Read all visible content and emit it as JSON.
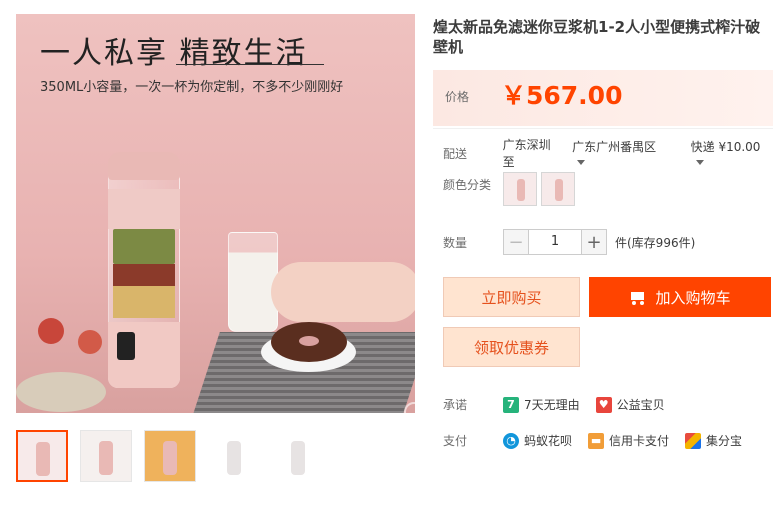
{
  "hero": {
    "title": "一人私享 精致生活",
    "subtitle": "350ML小容量，一次一杯为你定制，不多不少刚刚好"
  },
  "product": {
    "title": "煌太新品免滤迷你豆浆机1-2人小型便携式榨汁破壁机",
    "price_label": "价格",
    "price": "￥567.00"
  },
  "shipping": {
    "label": "配送",
    "from": "广东深圳 至",
    "to": "广东广州番禺区",
    "fee": "快递 ¥10.00"
  },
  "color": {
    "label": "颜色分类"
  },
  "quantity": {
    "label": "数量",
    "value": "1",
    "minus": "−",
    "plus": "+",
    "stock": "件(库存996件)"
  },
  "actions": {
    "buy_now": "立即购买",
    "add_cart": "加入购物车",
    "coupon": "领取优惠券"
  },
  "promise": {
    "label": "承诺",
    "items": [
      "7天无理由",
      "公益宝贝"
    ],
    "icon7": "7"
  },
  "payment": {
    "label": "支付",
    "items": [
      "蚂蚁花呗",
      "信用卡支付",
      "集分宝"
    ]
  },
  "colors": {
    "price": "#ff4400",
    "buy_bg": "#ffe4d0",
    "cart_bg": "#ff4400"
  }
}
